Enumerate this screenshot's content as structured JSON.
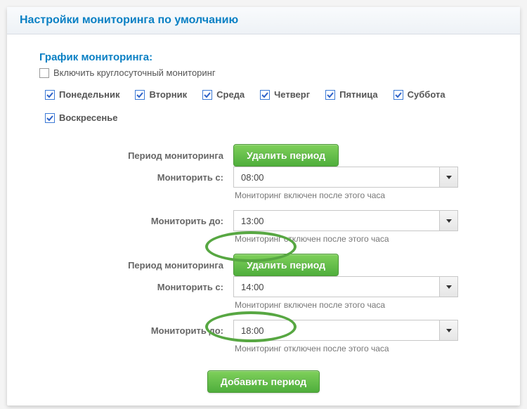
{
  "header": {
    "title": "Настройки мониторинга по умолчанию"
  },
  "schedule": {
    "section_label": "График мониторинга:",
    "enable_247": {
      "label": "Включить круглосуточный мониторинг",
      "checked": false
    },
    "days": [
      {
        "label": "Понедельник",
        "checked": true
      },
      {
        "label": "Вторник",
        "checked": true
      },
      {
        "label": "Среда",
        "checked": true
      },
      {
        "label": "Четверг",
        "checked": true
      },
      {
        "label": "Пятница",
        "checked": true
      },
      {
        "label": "Суббота",
        "checked": true
      },
      {
        "label": "Воскресенье",
        "checked": true
      }
    ],
    "period_label": "Период мониторинга",
    "delete_label": "Удалить период",
    "from_label": "Мониторить с:",
    "to_label": "Мониторить до:",
    "from_hint": "Мониторинг включен после этого часа",
    "to_hint": "Мониторинг отключен после этого часа",
    "add_label": "Добавить период",
    "periods": [
      {
        "from": "08:00",
        "to": "13:00"
      },
      {
        "from": "14:00",
        "to": "18:00"
      }
    ]
  }
}
